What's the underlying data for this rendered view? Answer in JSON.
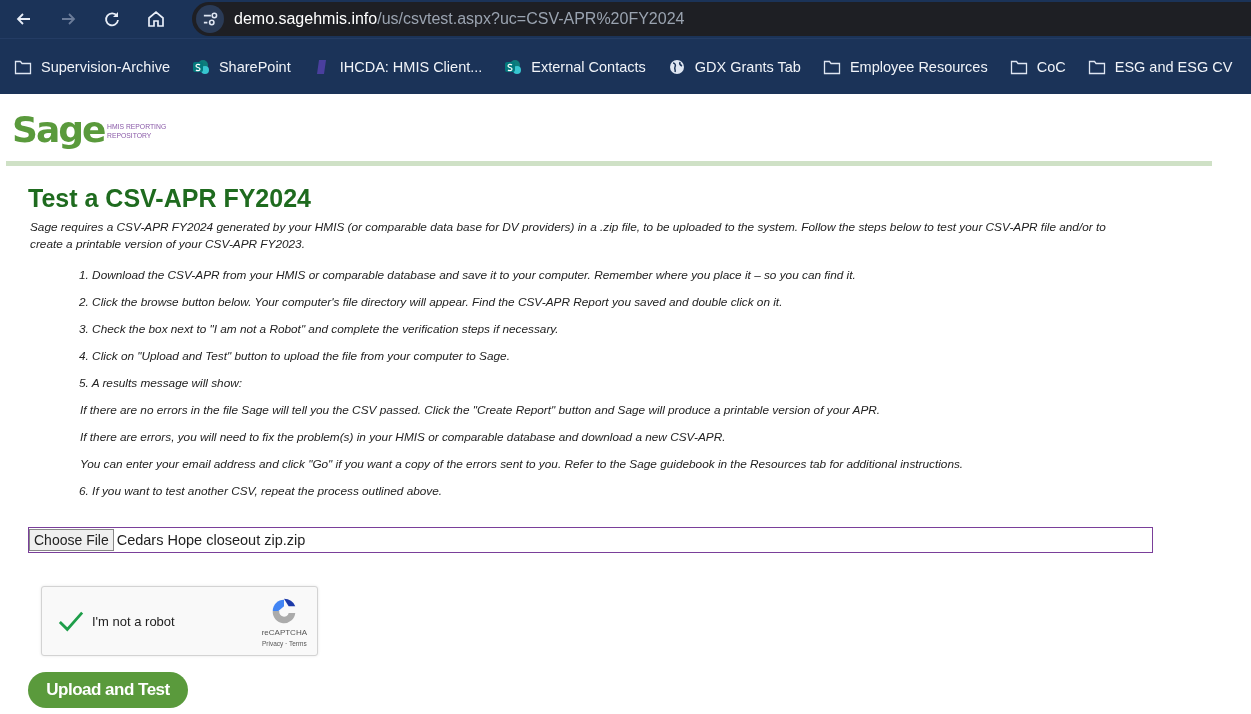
{
  "browser": {
    "url_host": "demo.sagehmis.info",
    "url_path": "/us/csvtest.aspx?uc=CSV-APR%20FY2024",
    "forward_disabled": true,
    "bookmarks": [
      {
        "kind": "folder",
        "label": "Supervision-Archive"
      },
      {
        "kind": "sharepoint",
        "label": "SharePoint"
      },
      {
        "kind": "bookmark",
        "label": "IHCDA: HMIS Client..."
      },
      {
        "kind": "sharepoint",
        "label": "External Contacts"
      },
      {
        "kind": "globe",
        "label": "GDX Grants Tab"
      },
      {
        "kind": "folder",
        "label": "Employee Resources"
      },
      {
        "kind": "folder",
        "label": "CoC"
      },
      {
        "kind": "folder",
        "label": "ESG and ESG CV"
      }
    ]
  },
  "logo": {
    "word": "Sage",
    "tagline_1": "HMIS REPORTING",
    "tagline_2": "REPOSITORY"
  },
  "title": "Test a CSV-APR FY2024",
  "intro": "Sage requires a CSV-APR FY2024 generated by your HMIS (or comparable data base for DV providers) in a .zip file, to be uploaded to the system. Follow the steps below to test your CSV-APR file and/or to create a printable version of your CSV-APR FY2023.",
  "steps": [
    {
      "kind": "step",
      "text": "1. Download the CSV-APR from your HMIS or comparable database and save it to your computer. Remember where you place it – so you can find it."
    },
    {
      "kind": "step",
      "text": "2. Click the browse button below. Your computer's file directory will appear. Find the CSV-APR Report you saved and double click on it."
    },
    {
      "kind": "step",
      "text": "3. Check the box next to \"I am not a Robot\" and complete the verification steps if necessary."
    },
    {
      "kind": "step",
      "text": "4. Click on \"Upload and Test\" button to upload the file from your computer to Sage."
    },
    {
      "kind": "step",
      "text": "5. A results message will show:"
    },
    {
      "kind": "note",
      "text": "If there are no errors in the file Sage will tell you the CSV passed. Click the \"Create Report\" button and Sage will produce a printable version of your APR."
    },
    {
      "kind": "note",
      "text": "If there are errors, you will need to fix the problem(s) in your HMIS or comparable database and download a new CSV-APR."
    },
    {
      "kind": "note",
      "text": "You can enter your email address and click \"Go\" if you want a copy of the errors sent to you. Refer to the Sage guidebook in the Resources tab for additional instructions."
    },
    {
      "kind": "step",
      "text": "6. If you want to test another CSV, repeat the process outlined above."
    }
  ],
  "file_input": {
    "button": "Choose File",
    "value": "Cedars Hope closeout zip.zip"
  },
  "captcha": {
    "checked": true,
    "label": "I'm not a robot",
    "brand": "reCAPTCHA",
    "links": "Privacy · Terms"
  },
  "submit": "Upload and Test"
}
